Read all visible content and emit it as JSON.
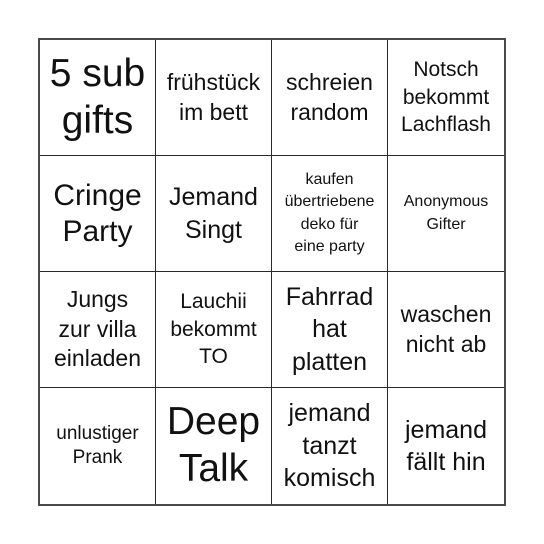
{
  "card": {
    "cells": [
      {
        "text": "5 sub\ngifts"
      },
      {
        "text": "frühstück\nim bett"
      },
      {
        "text": "schreien\nrandom"
      },
      {
        "text": "Notsch\nbekommt\nLachflash"
      },
      {
        "text": "Cringe\nParty"
      },
      {
        "text": "Jemand\nSingt"
      },
      {
        "text": "kaufen\nübertriebene\ndeko für\neine party"
      },
      {
        "text": "Anonymous\nGifter"
      },
      {
        "text": "Jungs\nzur villa\neinladen"
      },
      {
        "text": "Lauchii\nbekommt\nTO"
      },
      {
        "text": "Fahrrad\nhat\nplatten"
      },
      {
        "text": "waschen\nnicht ab"
      },
      {
        "text": "unlustiger\nPrank"
      },
      {
        "text": "Deep\nTalk"
      },
      {
        "text": "jemand\ntanzt\nkomisch"
      },
      {
        "text": "jemand\nfällt hin"
      }
    ]
  }
}
